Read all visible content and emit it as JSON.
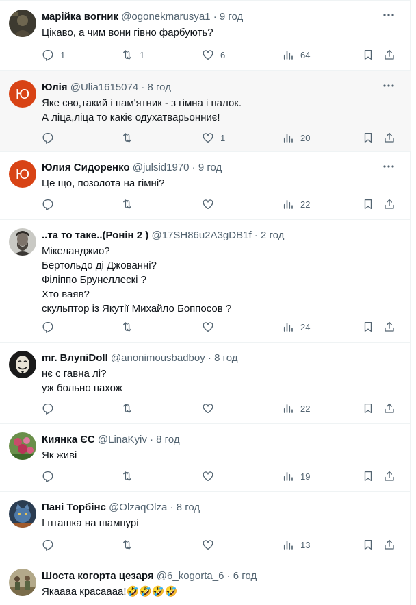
{
  "posts": [
    {
      "name": "марійка вогник",
      "handle": "@ogonekmarusya1",
      "time": "9 год",
      "avatar_icon": "dark-photo-avatar",
      "lines": [
        "Цікаво, а чим вони гівно фарбують?"
      ],
      "replies": "1",
      "retweets": "1",
      "likes": "6",
      "views": "64"
    },
    {
      "name": "Юлія",
      "handle": "@Ulia1615074",
      "time": "8 год",
      "avatar_letter": "Ю",
      "avatar_color": "#d84315",
      "lines": [
        "Яке сво,такий і пам'ятник - з гімна і палок.",
        "А ліца,ліца то какіє одухатварьонниє!"
      ],
      "replies": "",
      "retweets": "",
      "likes": "1",
      "views": "20"
    },
    {
      "name": "Юлия Сидоренко",
      "handle": "@julsid1970",
      "time": "9 год",
      "avatar_letter": "Ю",
      "avatar_color": "#d84315",
      "lines": [
        "Це що, позолота на гімні?"
      ],
      "replies": "",
      "retweets": "",
      "likes": "",
      "views": "22"
    },
    {
      "name": "..та то таке..(Ронін 2 )",
      "handle": "@17SH86u2A3gDB1f",
      "time": "2 год",
      "avatar_icon": "bearded-man-avatar",
      "lines": [
        "Мікеланджио?",
        "Бертольдо ді Джованні?",
        "Філіппо Брунеллескі ?",
        "Хто ваяв?",
        "скульптор із Якутії Михайло Боппосов ?"
      ],
      "replies": "",
      "retweets": "",
      "likes": "",
      "views": "24"
    },
    {
      "name": "mr. ВлупіDoll",
      "handle": "@anonimousbadboy",
      "time": "8 год",
      "avatar_icon": "anonymous-mask-avatar",
      "lines": [
        "нє с гавна лі?",
        "уж больно пахож"
      ],
      "replies": "",
      "retweets": "",
      "likes": "",
      "views": "22"
    },
    {
      "name": "Киянка ЄС",
      "handle": "@LinaKyiv",
      "time": "8 год",
      "avatar_icon": "flowers-avatar",
      "lines": [
        "Як живі"
      ],
      "replies": "",
      "retweets": "",
      "likes": "",
      "views": "19"
    },
    {
      "name": "Пані Торбінс",
      "handle": "@OlzaqOlza",
      "time": "8 год",
      "avatar_icon": "blue-cat-avatar",
      "lines": [
        "І пташка на шампурі"
      ],
      "replies": "",
      "retweets": "",
      "likes": "",
      "views": "13"
    },
    {
      "name": "Шоста когорта цезаря",
      "handle": "@6_kogorta_6",
      "time": "6 год",
      "avatar_icon": "soldiers-avatar",
      "lines": [
        "Якаааа красаааа!🤣🤣🤣🤣"
      ],
      "replies": "",
      "retweets": "",
      "likes": "",
      "views": ""
    }
  ],
  "colors": {
    "text": "#0f1419",
    "muted": "#536471",
    "border": "#eff3f4",
    "highlight": "#f7f7f7"
  }
}
